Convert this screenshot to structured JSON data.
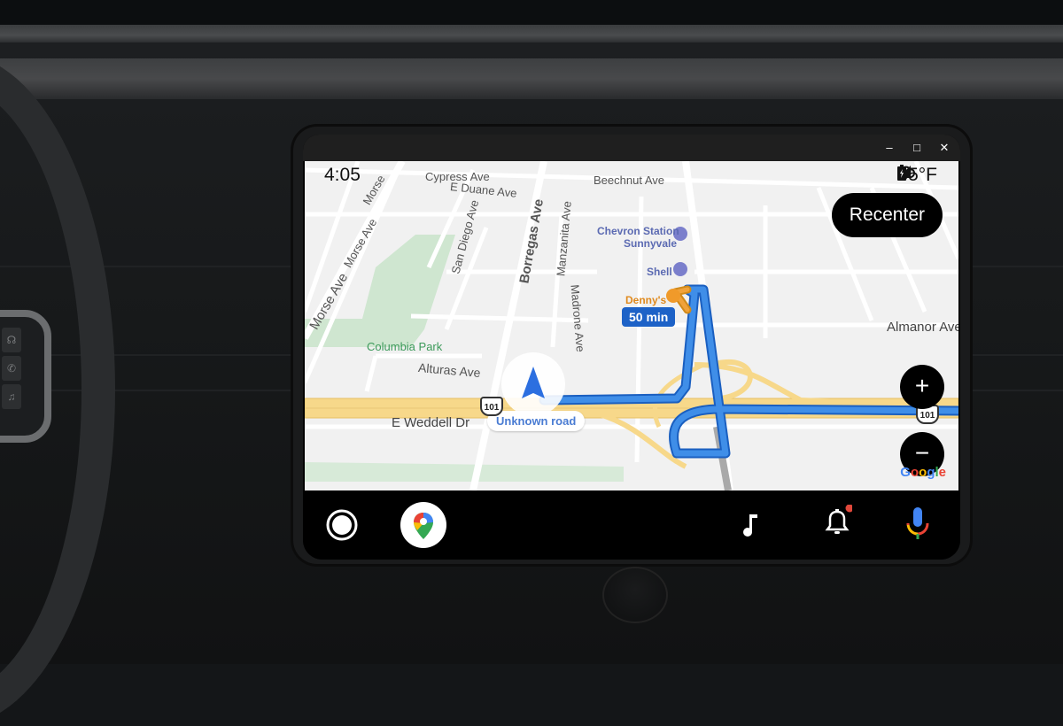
{
  "window": {
    "controls": {
      "minimize": "–",
      "maximize": "□",
      "close": "✕"
    }
  },
  "status_bar": {
    "time": "4:05",
    "weather_icon": "cloud-icon",
    "temperature": "35°F",
    "signal_icon": "cellular-signal-icon",
    "battery_icon": "battery-charging-icon"
  },
  "map": {
    "recenter_label": "Recenter",
    "zoom_in_label": "+",
    "zoom_out_label": "−",
    "eta": "50 min",
    "current_road": "Unknown road",
    "highway_shield": "101",
    "attribution": "Google",
    "street_labels": {
      "cypress": "Cypress Ave",
      "duane": "E Duane Ave",
      "beechnut": "Beechnut Ave",
      "morse1": "Morse Ave",
      "morse2": "Morse Ave",
      "morse3": "Morse",
      "san_diego": "San Diego Ave",
      "borregas": "Borregas Ave",
      "manzanita": "Manzanita Ave",
      "madrone": "Madrone Ave",
      "alturas": "Alturas Ave",
      "weddell": "E Weddell Dr",
      "almanor": "Almanor Ave"
    },
    "places": {
      "park": "Columbia Park",
      "chevron_line1": "Chevron Station",
      "chevron_line2": "Sunnyvale",
      "shell": "Shell",
      "dennys": "Denny's"
    }
  },
  "navbar": {
    "home": "home-button",
    "maps": "google-maps-app",
    "music": "music-app",
    "notifications": "notifications",
    "assistant": "voice-assistant"
  },
  "colors": {
    "route": "#3f8ee8",
    "route_border": "#1a5fc0",
    "highway": "#f7d88a",
    "park": "#cfe6d0",
    "eta_badge": "#1d62c7",
    "notification_dot": "#e0483b"
  }
}
